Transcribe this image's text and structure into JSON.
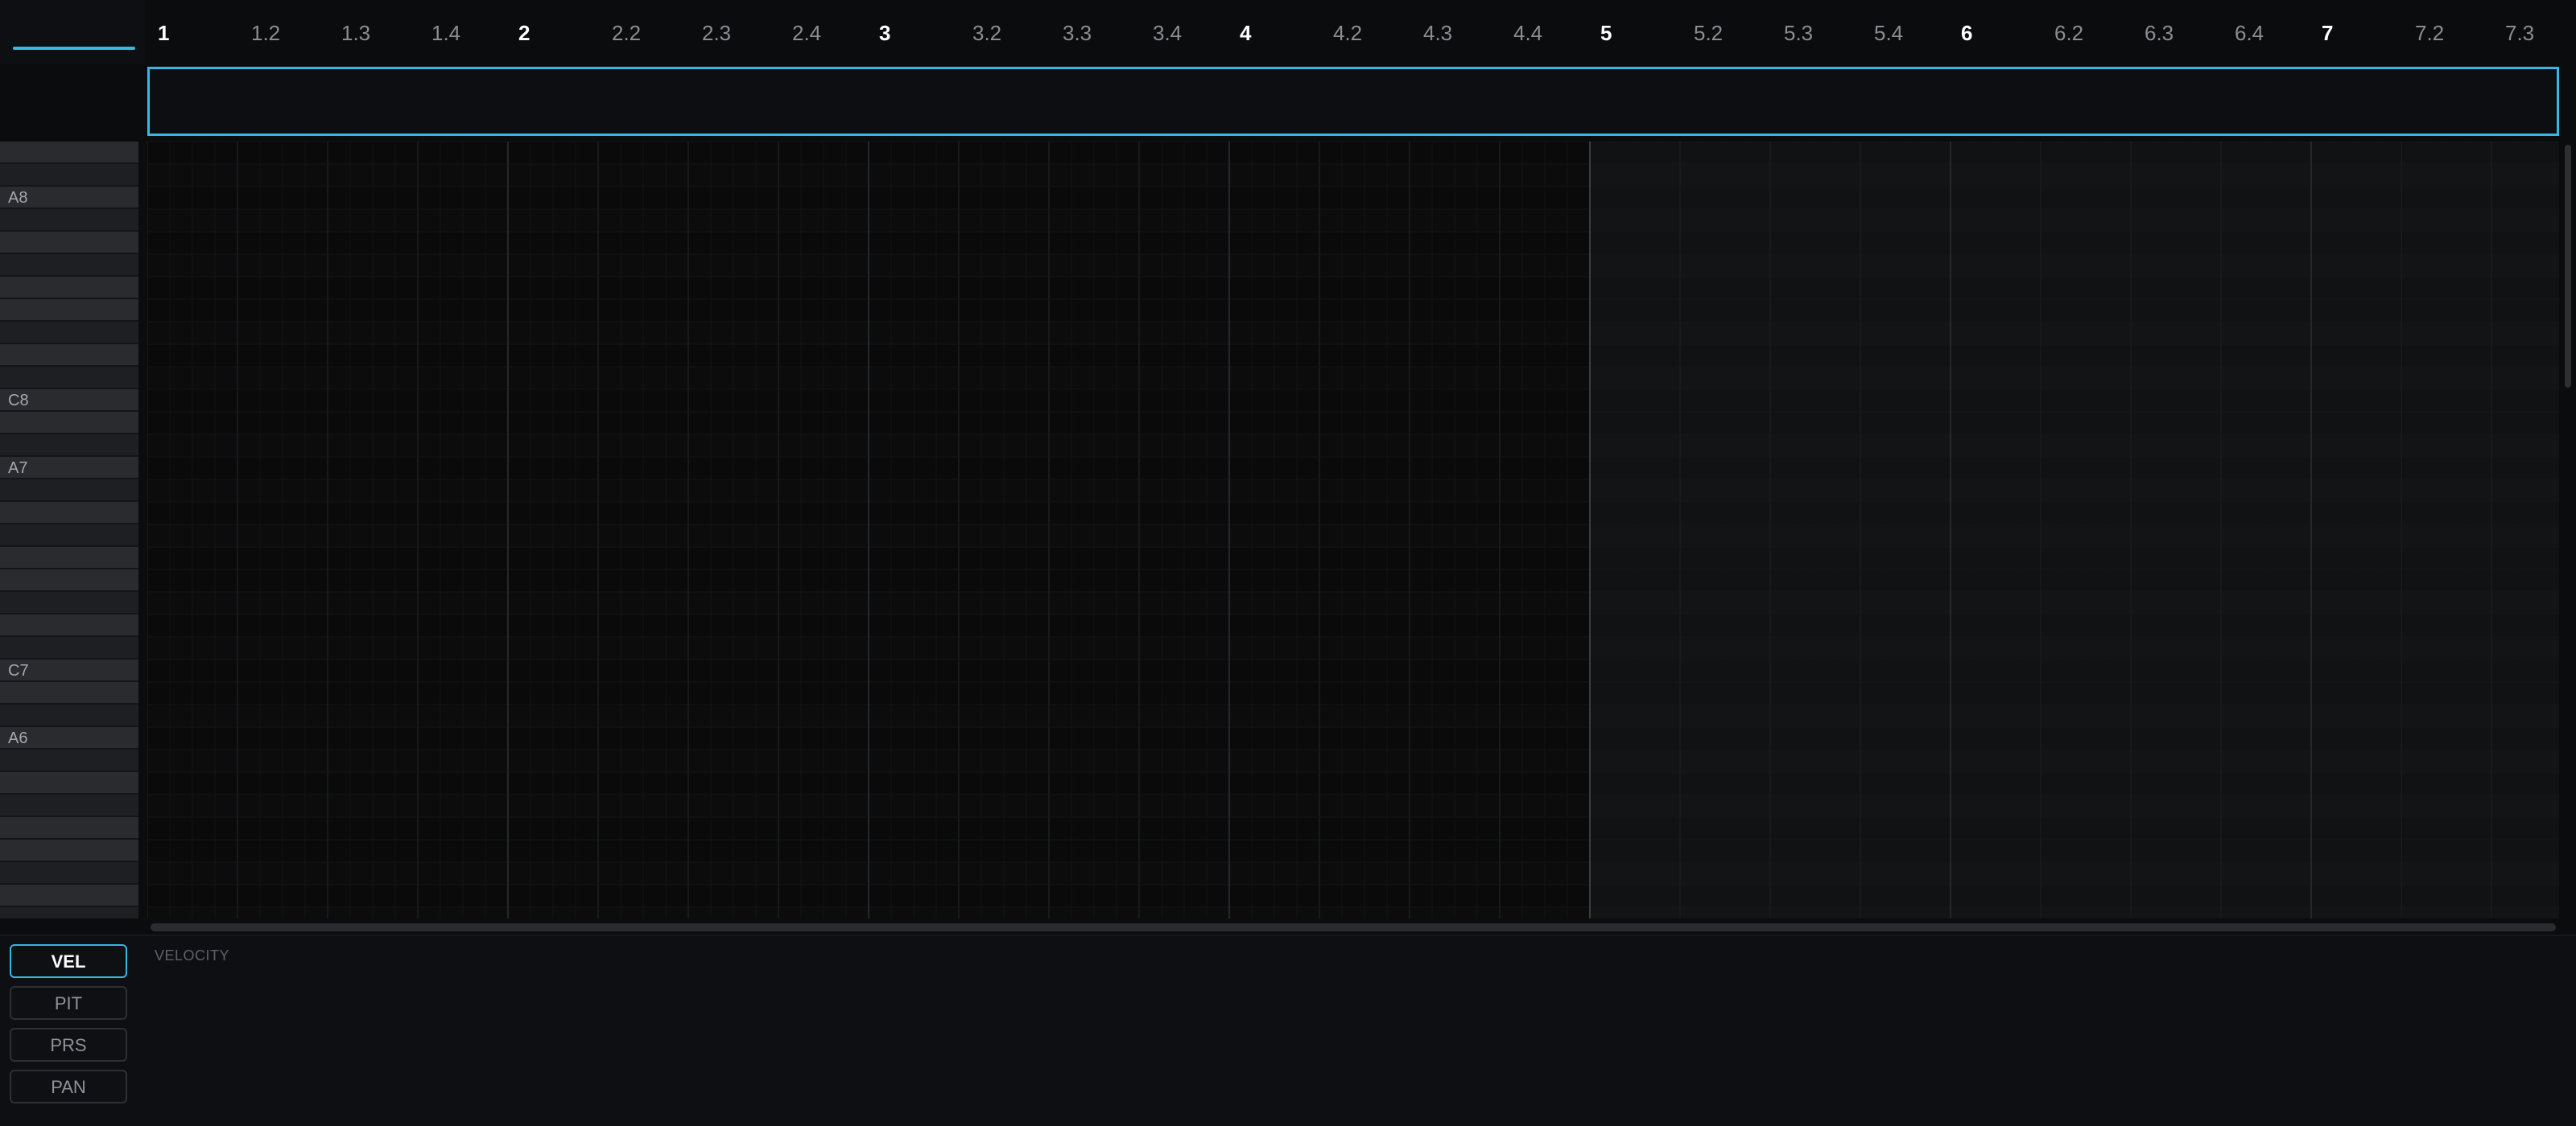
{
  "ruler": {
    "ticks": [
      {
        "label": "1",
        "bar": true
      },
      {
        "label": "1.2",
        "bar": false
      },
      {
        "label": "1.3",
        "bar": false
      },
      {
        "label": "1.4",
        "bar": false
      },
      {
        "label": "2",
        "bar": true
      },
      {
        "label": "2.2",
        "bar": false
      },
      {
        "label": "2.3",
        "bar": false
      },
      {
        "label": "2.4",
        "bar": false
      },
      {
        "label": "3",
        "bar": true
      },
      {
        "label": "3.2",
        "bar": false
      },
      {
        "label": "3.3",
        "bar": false
      },
      {
        "label": "3.4",
        "bar": false
      },
      {
        "label": "4",
        "bar": true
      },
      {
        "label": "4.2",
        "bar": false
      },
      {
        "label": "4.3",
        "bar": false
      },
      {
        "label": "4.4",
        "bar": false
      },
      {
        "label": "5",
        "bar": true
      },
      {
        "label": "5.2",
        "bar": false
      },
      {
        "label": "5.3",
        "bar": false
      },
      {
        "label": "5.4",
        "bar": false
      },
      {
        "label": "6",
        "bar": true
      },
      {
        "label": "6.2",
        "bar": false
      },
      {
        "label": "6.3",
        "bar": false
      },
      {
        "label": "6.4",
        "bar": false
      },
      {
        "label": "7",
        "bar": true
      },
      {
        "label": "7.2",
        "bar": false
      },
      {
        "label": "7.3",
        "bar": false
      }
    ]
  },
  "keyboard": {
    "labels": {
      "A8": "A8",
      "C8": "C8",
      "A7": "A7",
      "C7": "C7",
      "A6": "A6"
    }
  },
  "lanes": {
    "buttons": [
      {
        "id": "vel",
        "label": "VEL",
        "active": true
      },
      {
        "id": "pit",
        "label": "PIT",
        "active": false
      },
      {
        "id": "prs",
        "label": "PRS",
        "active": false
      },
      {
        "id": "pan",
        "label": "PAN",
        "active": false
      }
    ],
    "current_title": "VELOCITY"
  },
  "colors": {
    "accent": "#35b7e8",
    "background": "#0b0c0e",
    "white_key": "#2a2b2f",
    "black_key": "#1e1f23"
  }
}
